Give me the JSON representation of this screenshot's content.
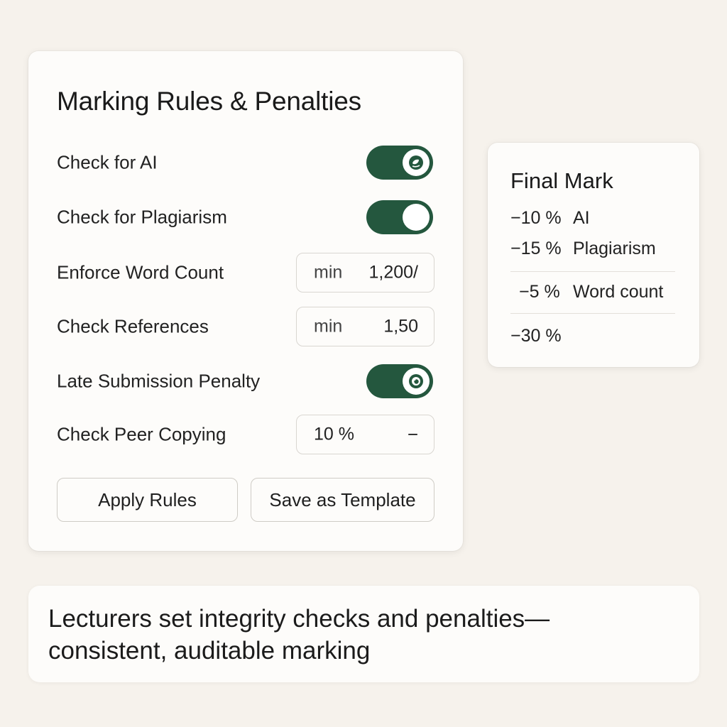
{
  "rules_panel": {
    "title": "Marking Rules & Penalties",
    "rows": [
      {
        "label": "Check for AI",
        "control": "toggle",
        "on": true,
        "knob_icon": "leaf-icon"
      },
      {
        "label": "Check for Plagiarism",
        "control": "toggle",
        "on": true,
        "knob_icon": ""
      },
      {
        "label": "Enforce Word Count",
        "control": "input",
        "prefix": "min",
        "value": "1,200/"
      },
      {
        "label": "Check References",
        "control": "input",
        "prefix": "min",
        "value": "1,50"
      },
      {
        "label": "Late Submission Penalty",
        "control": "toggle",
        "on": true,
        "knob_icon": "eye-icon"
      },
      {
        "label": "Check Peer Copying",
        "control": "stepper",
        "value": "10 %",
        "minus": "−"
      }
    ],
    "apply_label": "Apply Rules",
    "save_label": "Save as Template"
  },
  "final_mark": {
    "title": "Final Mark",
    "penalties": [
      {
        "value": "−10 %",
        "label": "AI"
      },
      {
        "value": "−15 %",
        "label": "Plagiarism"
      },
      {
        "value": "−5 %",
        "label": "Word count"
      }
    ],
    "total": "−30 %"
  },
  "caption": {
    "line1": "Lecturers set integrity checks and penalties—",
    "line2": "consistent, auditable marking"
  },
  "colors": {
    "accent": "#24573e",
    "background": "#f6f2ec",
    "card": "#fdfcfa"
  }
}
